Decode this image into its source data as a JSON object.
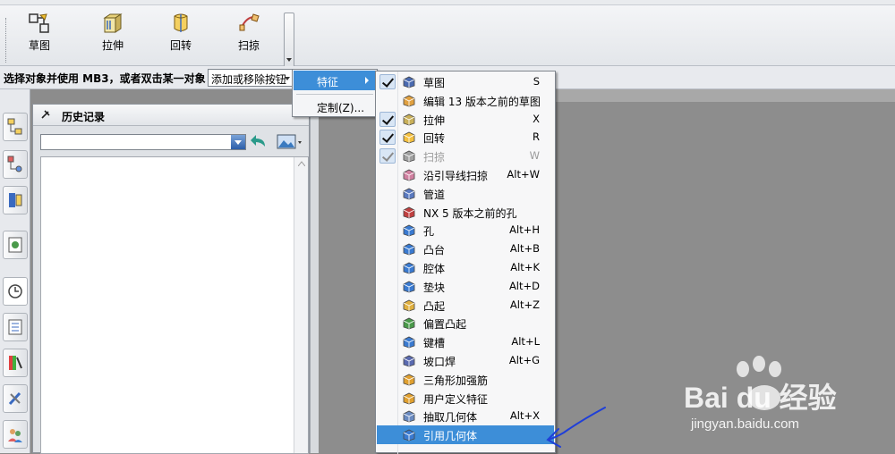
{
  "toolbar": {
    "buttons": [
      {
        "label": "草图",
        "icon": "sketch-icon"
      },
      {
        "label": "拉伸",
        "icon": "extrude-icon"
      },
      {
        "label": "回转",
        "icon": "revolve-icon"
      },
      {
        "label": "扫掠",
        "icon": "sweep-icon"
      }
    ]
  },
  "selection_bar": {
    "prompt": "选择对象并使用 MB3，或者双击某一对象",
    "add_remove_label": "添加或移除按钮"
  },
  "history_panel": {
    "title": "历史记录"
  },
  "menu": {
    "feature_label": "特征",
    "customize_label": "定制(Z)..."
  },
  "submenu": {
    "items": [
      {
        "name": "草图",
        "shortcut": "S",
        "checked": true,
        "icon": "sketch-icon"
      },
      {
        "name": "编辑 13 版本之前的草图",
        "shortcut": "",
        "checked": false,
        "icon": "legacy-sketch-icon"
      },
      {
        "name": "拉伸",
        "shortcut": "X",
        "checked": true,
        "icon": "extrude-icon"
      },
      {
        "name": "回转",
        "shortcut": "R",
        "checked": true,
        "icon": "revolve-icon"
      },
      {
        "name": "扫掠",
        "shortcut": "W",
        "checked": true,
        "disabled": true,
        "icon": "sweep-icon"
      },
      {
        "name": "沿引导线扫掠",
        "shortcut": "Alt+W",
        "checked": false,
        "icon": "guide-sweep-icon"
      },
      {
        "name": "管道",
        "shortcut": "",
        "checked": false,
        "icon": "tube-icon"
      },
      {
        "name": "NX 5 版本之前的孔",
        "shortcut": "",
        "checked": false,
        "icon": "legacy-hole-icon"
      },
      {
        "name": "孔",
        "shortcut": "Alt+H",
        "checked": false,
        "icon": "hole-icon"
      },
      {
        "name": "凸台",
        "shortcut": "Alt+B",
        "checked": false,
        "icon": "boss-icon"
      },
      {
        "name": "腔体",
        "shortcut": "Alt+K",
        "checked": false,
        "icon": "pocket-icon"
      },
      {
        "name": "垫块",
        "shortcut": "Alt+D",
        "checked": false,
        "icon": "pad-icon"
      },
      {
        "name": "凸起",
        "shortcut": "Alt+Z",
        "checked": false,
        "icon": "emboss-icon"
      },
      {
        "name": "偏置凸起",
        "shortcut": "",
        "checked": false,
        "icon": "offset-emboss-icon"
      },
      {
        "name": "键槽",
        "shortcut": "Alt+L",
        "checked": false,
        "icon": "slot-icon"
      },
      {
        "name": "坡口焊",
        "shortcut": "Alt+G",
        "checked": false,
        "icon": "groove-icon"
      },
      {
        "name": "三角形加强筋",
        "shortcut": "",
        "checked": false,
        "icon": "dart-icon"
      },
      {
        "name": "用户定义特征",
        "shortcut": "",
        "checked": false,
        "icon": "udf-icon"
      },
      {
        "name": "抽取几何体",
        "shortcut": "Alt+X",
        "checked": false,
        "icon": "extract-icon"
      },
      {
        "name": "引用几何体",
        "shortcut": "",
        "checked": false,
        "highlighted": true,
        "icon": "instance-geometry-icon"
      }
    ]
  },
  "watermark": {
    "brand": "Bai du 经验",
    "url": "jingyan.baidu.com"
  },
  "colors": {
    "menu_highlight": "#3d8ed8",
    "graphics_bg": "#8d8d8d",
    "annotation": "#1f3fd8"
  }
}
